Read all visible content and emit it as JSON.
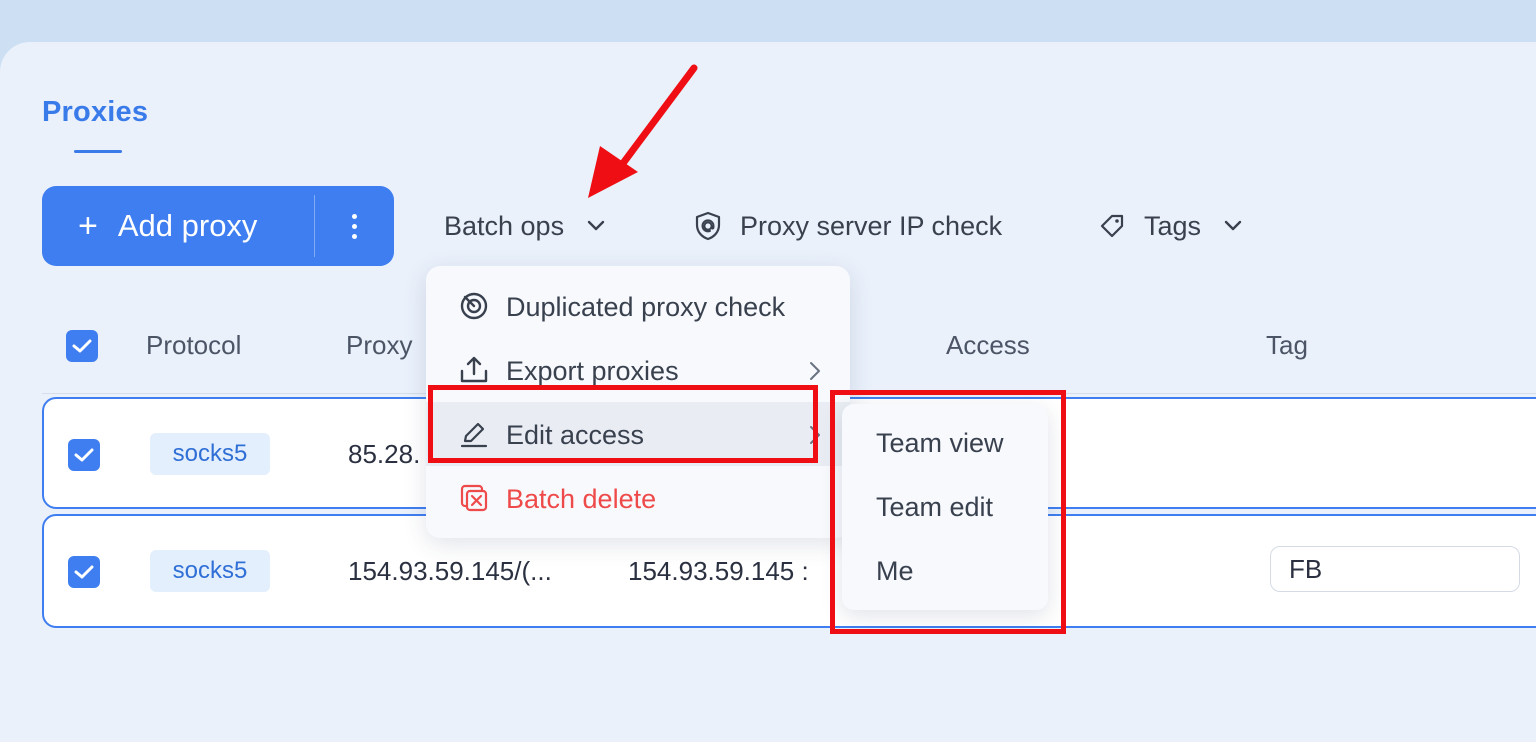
{
  "tabs": {
    "active": "Proxies"
  },
  "toolbar": {
    "add_proxy_label": "Add proxy",
    "batch_ops_label": "Batch ops",
    "ip_check_label": "Proxy server IP check",
    "tags_label": "Tags"
  },
  "table": {
    "headers": [
      "Protocol",
      "Proxy",
      "Access",
      "Tag"
    ],
    "rows": [
      {
        "protocol": "socks5",
        "proxy": "85.28.",
        "tag": ""
      },
      {
        "protocol": "socks5",
        "proxy": "154.93.59.145/(...",
        "host": "154.93.59.145 : ",
        "tag": "FB"
      }
    ]
  },
  "batch_menu": {
    "items": [
      {
        "label": "Duplicated proxy check",
        "icon": "radar-icon"
      },
      {
        "label": "Export proxies",
        "icon": "upload-icon",
        "has_submenu": true
      },
      {
        "label": "Edit access",
        "icon": "pencil-icon",
        "has_submenu": true,
        "highlighted": true
      },
      {
        "label": "Batch delete",
        "icon": "delete-box-icon",
        "danger": true
      }
    ]
  },
  "access_submenu": {
    "items": [
      "Team view",
      "Team edit",
      "Me"
    ]
  },
  "colors": {
    "accent": "#3f7ef0",
    "danger": "#ef4a4a",
    "annotation_red": "#ee0e13"
  }
}
